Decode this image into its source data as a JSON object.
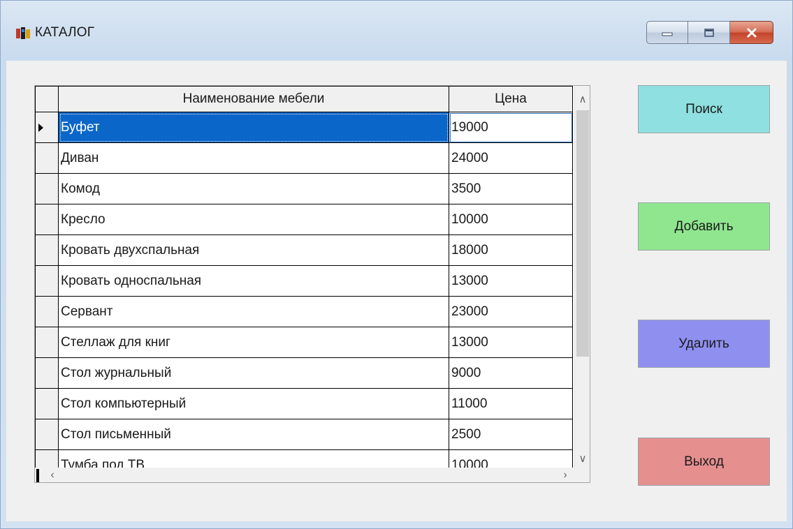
{
  "window": {
    "title": "КАТАЛОГ"
  },
  "grid": {
    "columns": [
      "Наименование мебели",
      "Цена"
    ],
    "rows": [
      {
        "name": "Буфет",
        "price": "19000",
        "selected": true
      },
      {
        "name": "Диван",
        "price": "24000"
      },
      {
        "name": "Комод",
        "price": "3500"
      },
      {
        "name": "Кресло",
        "price": "10000"
      },
      {
        "name": "Кровать двухспальная",
        "price": "18000"
      },
      {
        "name": "Кровать односпальная",
        "price": "13000"
      },
      {
        "name": "Сервант",
        "price": "23000"
      },
      {
        "name": "Стеллаж для книг",
        "price": "13000"
      },
      {
        "name": "Стол журнальный",
        "price": "9000"
      },
      {
        "name": "Стол компьютерный",
        "price": "11000"
      },
      {
        "name": "Стол письменный",
        "price": "2500"
      },
      {
        "name": "Тумба под ТВ",
        "price": "10000"
      }
    ]
  },
  "buttons": {
    "search": "Поиск",
    "add": "Добавить",
    "delete": "Удалить",
    "exit": "Выход"
  },
  "colors": {
    "search": "#8fe0e0",
    "add": "#8fe68f",
    "delete": "#8f8ff0",
    "exit": "#e58f8f",
    "selection": "#0a66c8"
  }
}
